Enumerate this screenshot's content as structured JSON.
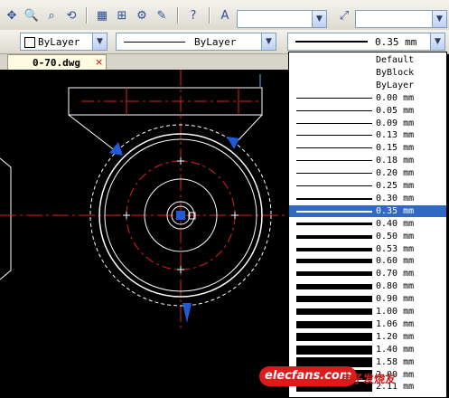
{
  "layer_combo": {
    "value": "ByLayer"
  },
  "linetype_combo": {
    "value": "ByLayer"
  },
  "lineweight_combo": {
    "value": "0.35 mm"
  },
  "file_tab": {
    "name": "0-70.dwg",
    "close": "×"
  },
  "lineweight_options": [
    {
      "label": "Default",
      "weight": 0
    },
    {
      "label": "ByBlock",
      "weight": 0
    },
    {
      "label": "ByLayer",
      "weight": 0
    },
    {
      "label": "0.00 mm",
      "weight": 1
    },
    {
      "label": "0.05 mm",
      "weight": 1
    },
    {
      "label": "0.09 mm",
      "weight": 1
    },
    {
      "label": "0.13 mm",
      "weight": 1
    },
    {
      "label": "0.15 mm",
      "weight": 1
    },
    {
      "label": "0.18 mm",
      "weight": 1
    },
    {
      "label": "0.20 mm",
      "weight": 1
    },
    {
      "label": "0.25 mm",
      "weight": 1
    },
    {
      "label": "0.30 mm",
      "weight": 2
    },
    {
      "label": "0.35 mm",
      "weight": 2,
      "selected": true
    },
    {
      "label": "0.40 mm",
      "weight": 3
    },
    {
      "label": "0.50 mm",
      "weight": 4
    },
    {
      "label": "0.53 mm",
      "weight": 4
    },
    {
      "label": "0.60 mm",
      "weight": 5
    },
    {
      "label": "0.70 mm",
      "weight": 5
    },
    {
      "label": "0.80 mm",
      "weight": 6
    },
    {
      "label": "0.90 mm",
      "weight": 7
    },
    {
      "label": "1.00 mm",
      "weight": 7
    },
    {
      "label": "1.06 mm",
      "weight": 8
    },
    {
      "label": "1.20 mm",
      "weight": 9
    },
    {
      "label": "1.40 mm",
      "weight": 10
    },
    {
      "label": "1.58 mm",
      "weight": 11
    },
    {
      "label": "2.00 mm",
      "weight": 11
    },
    {
      "label": "2.11 mm",
      "weight": 11
    }
  ],
  "watermark": {
    "site": "elecfans.com",
    "cn": "电子发烧友"
  },
  "colors": {
    "accent": "#316ac5",
    "center_line": "#e0201e",
    "grip": "#1f5bd6"
  }
}
